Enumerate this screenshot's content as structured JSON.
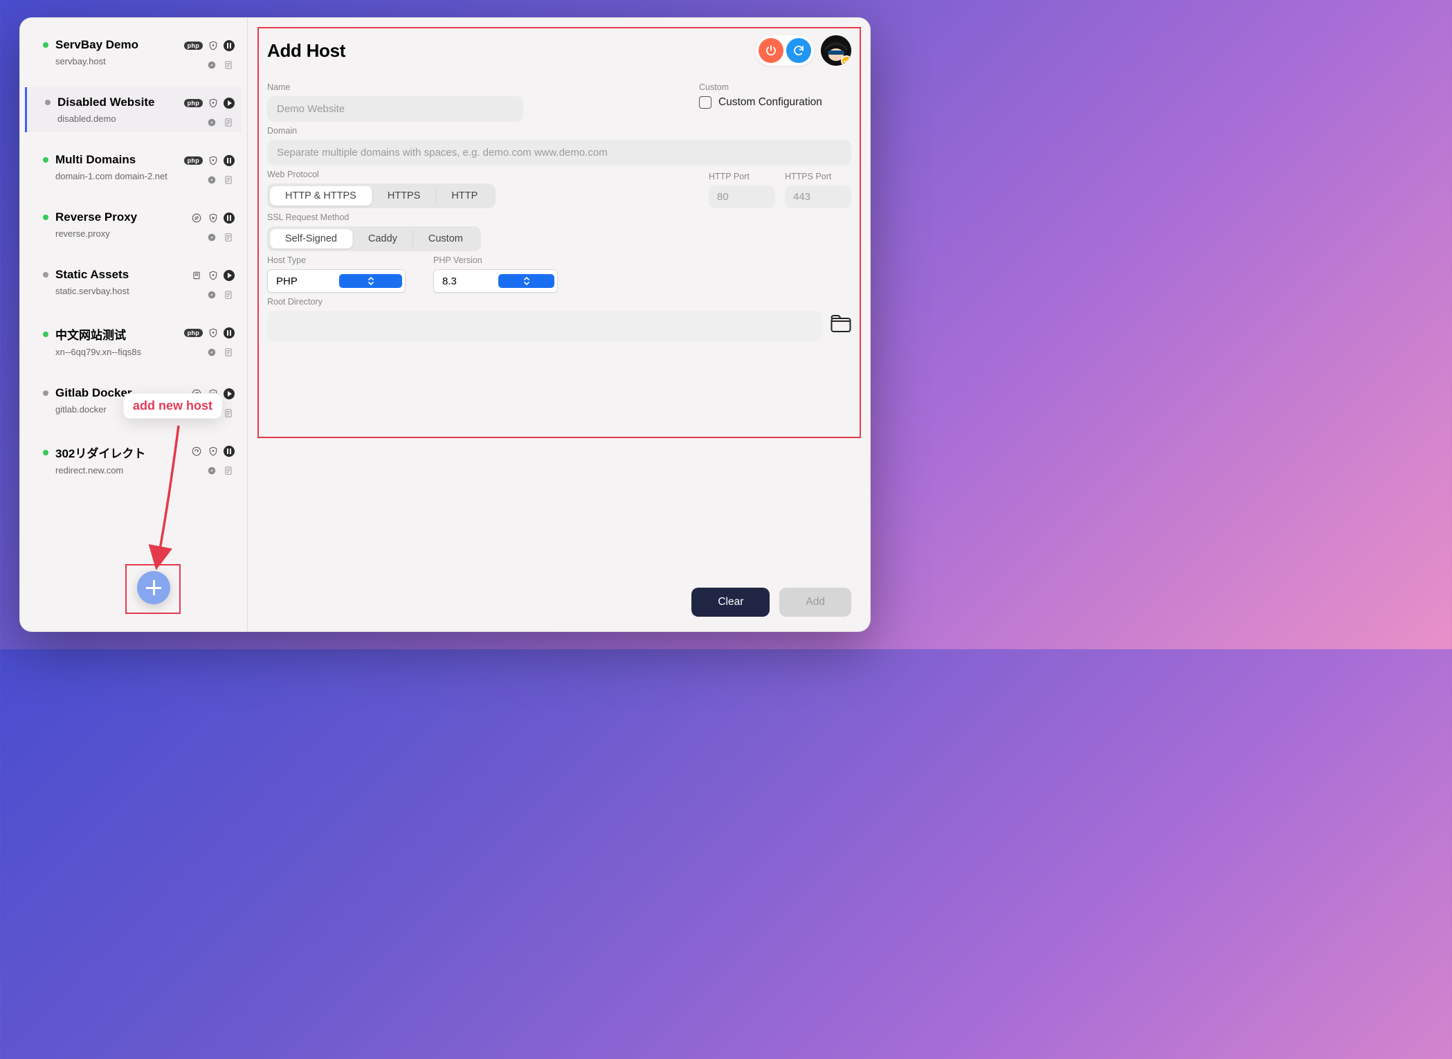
{
  "header": {
    "title": "Add Host"
  },
  "annotation": {
    "tooltip": "add new host"
  },
  "sidebar": {
    "sites": [
      {
        "name": "ServBay Demo",
        "domain": "servbay.host",
        "status": "green",
        "selected": false,
        "badge": "php",
        "action": "pause"
      },
      {
        "name": "Disabled Website",
        "domain": "disabled.demo",
        "status": "gray",
        "selected": true,
        "badge": "php",
        "action": "play"
      },
      {
        "name": "Multi Domains",
        "domain": "domain-1.com domain-2.net",
        "status": "green",
        "selected": false,
        "badge": "php",
        "action": "pause"
      },
      {
        "name": "Reverse Proxy",
        "domain": "reverse.proxy",
        "status": "green",
        "selected": false,
        "badge": "arrows",
        "action": "pause"
      },
      {
        "name": "Static Assets",
        "domain": "static.servbay.host",
        "status": "gray",
        "selected": false,
        "badge": "box",
        "action": "play"
      },
      {
        "name": "中文网站测试",
        "domain": "xn--6qq79v.xn--fiqs8s",
        "status": "green",
        "selected": false,
        "badge": "php",
        "action": "pause"
      },
      {
        "name": "Gitlab Docker",
        "domain": "gitlab.docker",
        "status": "gray",
        "selected": false,
        "badge": "arrows",
        "action": "play"
      },
      {
        "name": "302リダイレクト",
        "domain": "redirect.new.com",
        "status": "green",
        "selected": false,
        "badge": "redirect",
        "action": "pause"
      }
    ]
  },
  "form": {
    "name_label": "Name",
    "name_placeholder": "Demo Website",
    "custom_label": "Custom",
    "custom_checkbox_label": "Custom Configuration",
    "domain_label": "Domain",
    "domain_placeholder": "Separate multiple domains with spaces, e.g. demo.com www.demo.com",
    "web_protocol_label": "Web Protocol",
    "web_protocol_options": [
      "HTTP & HTTPS",
      "HTTPS",
      "HTTP"
    ],
    "web_protocol_selected": "HTTP & HTTPS",
    "http_port_label": "HTTP Port",
    "http_port_placeholder": "80",
    "https_port_label": "HTTPS Port",
    "https_port_placeholder": "443",
    "ssl_label": "SSL Request Method",
    "ssl_options": [
      "Self-Signed",
      "Caddy",
      "Custom"
    ],
    "ssl_selected": "Self-Signed",
    "host_type_label": "Host Type",
    "host_type_value": "PHP",
    "php_version_label": "PHP Version",
    "php_version_value": "8.3",
    "root_dir_label": "Root Directory"
  },
  "footer": {
    "clear": "Clear",
    "add": "Add"
  }
}
